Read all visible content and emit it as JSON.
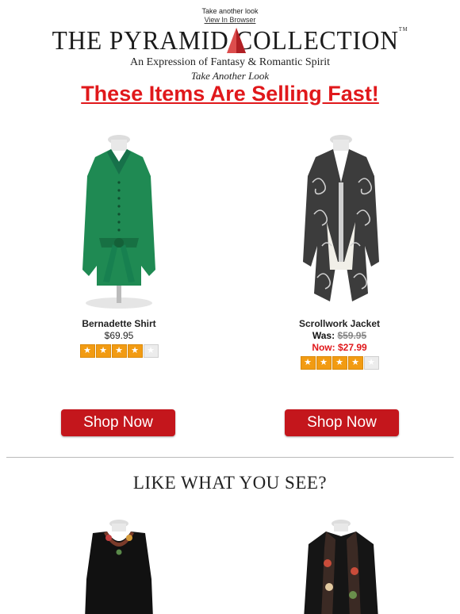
{
  "preheader": {
    "text": "Take another look",
    "view_in_browser": "View In Browser"
  },
  "logo": {
    "brand": "THE PYRAMID COLLECTION",
    "trademark": "TM",
    "tagline": "An Expression of Fantasy & Romantic Spirit",
    "subtitle": "Take Another Look"
  },
  "headline": "These Items Are Selling Fast!",
  "products": [
    {
      "name": "Bernadette Shirt",
      "price": "$69.95",
      "rating": 4,
      "max_rating": 5,
      "button": "Shop Now",
      "image_icon": "green-blouse-icon"
    },
    {
      "name": "Scrollwork Jacket",
      "was_label": "Was:",
      "was_price": "$59.95",
      "now_label": "Now:",
      "now_price": "$27.99",
      "rating": 4,
      "max_rating": 5,
      "button": "Shop Now",
      "image_icon": "scroll-jacket-icon"
    }
  ],
  "section2": {
    "title": "LIKE WHAT YOU SEE?"
  },
  "colors": {
    "accent_red": "#e0181b",
    "button_red": "#c4161c",
    "star_orange": "#f29b12",
    "green": "#1f8a53"
  }
}
